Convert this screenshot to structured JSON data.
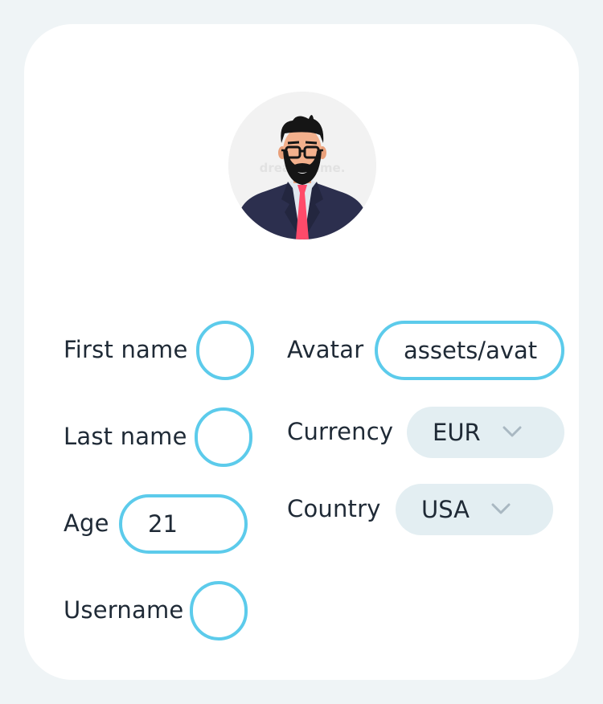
{
  "form": {
    "first_name": {
      "label": "First name",
      "value": ""
    },
    "last_name": {
      "label": "Last name",
      "value": ""
    },
    "age": {
      "label": "Age",
      "value": "21"
    },
    "username": {
      "label": "Username",
      "value": ""
    },
    "avatar": {
      "label": "Avatar",
      "value": "assets/avat"
    },
    "currency": {
      "label": "Currency",
      "selected": "EUR"
    },
    "country": {
      "label": "Country",
      "selected": "USA"
    }
  },
  "avatar_image": {
    "watermark": "dreamstime."
  },
  "colors": {
    "page_background": "#eff4f6",
    "card_background": "#ffffff",
    "input_border": "#5ccbeb",
    "select_background": "#e3eef2",
    "text": "#1f2a36",
    "chevron": "#a9b8c2"
  },
  "icons": {
    "select_arrow": "chevron-down-icon"
  }
}
